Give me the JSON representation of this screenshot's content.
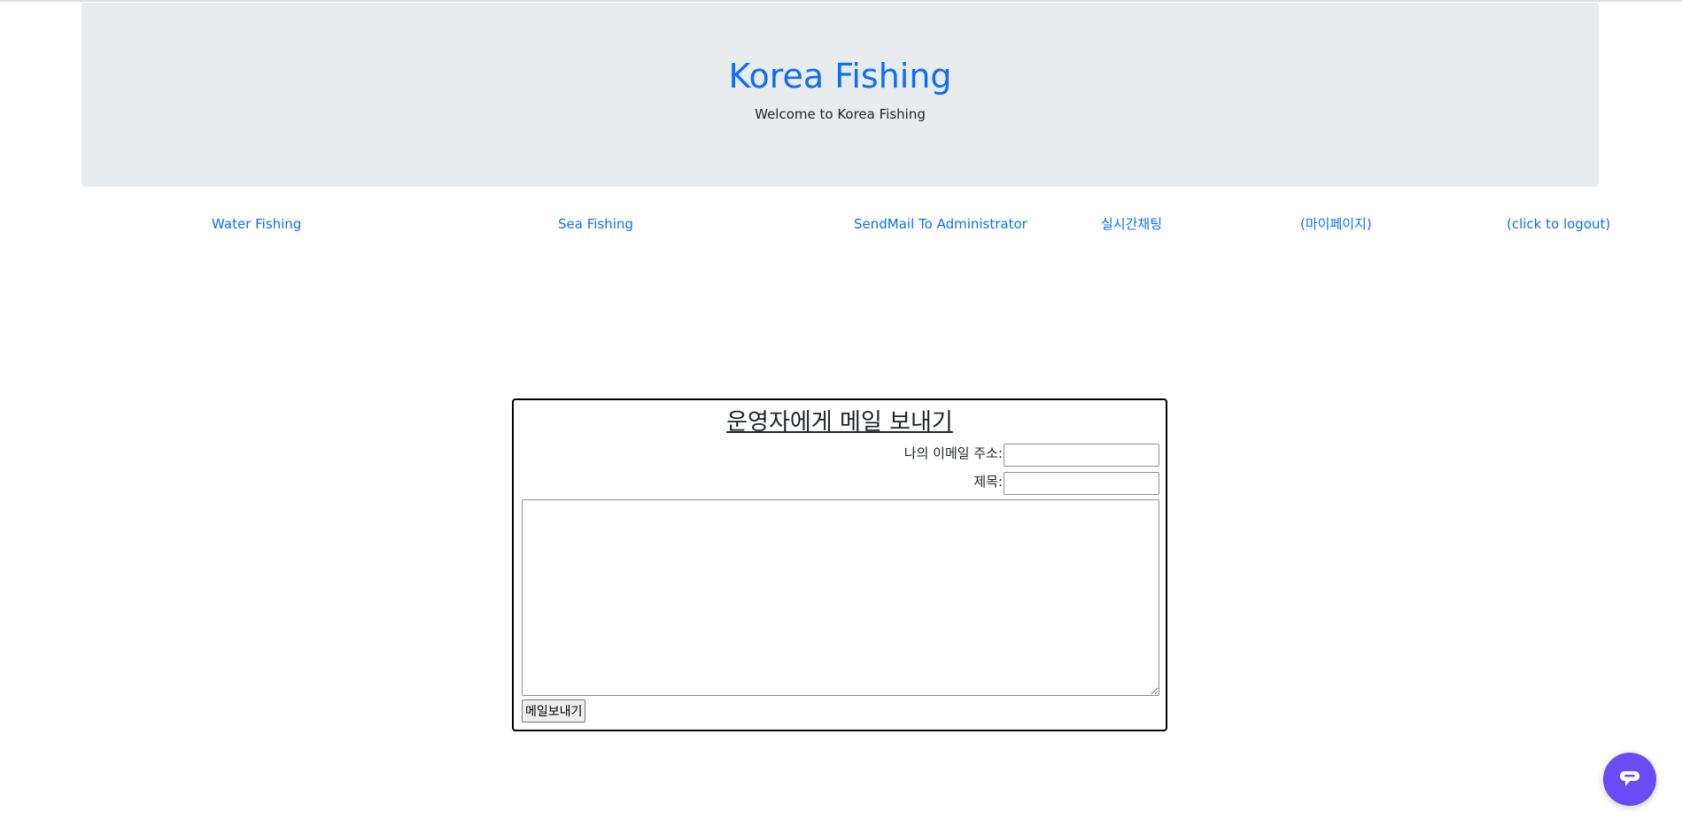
{
  "header": {
    "title": "Korea Fishing",
    "subtitle": "Welcome to Korea Fishing"
  },
  "nav": {
    "items": [
      {
        "label": "Water Fishing"
      },
      {
        "label": "Sea Fishing"
      },
      {
        "label": "SendMail To Administrator"
      },
      {
        "label": "실시간채팅"
      },
      {
        "label": "(마이페이지)"
      },
      {
        "label": "(click to logout)"
      }
    ]
  },
  "mail_form": {
    "heading": "운영자에게 메일 보내기",
    "email_label": "나의 이메일 주소:",
    "email_value": "",
    "subject_label": "제목:",
    "subject_value": "",
    "body_value": "",
    "submit_label": "메일보내기"
  },
  "chat_widget": {
    "icon": "chat-bubble-icon"
  },
  "colors": {
    "link": "#0d6efd",
    "jumbotron_bg": "#e9ecef",
    "chat_fab": "#6a4cf5"
  }
}
